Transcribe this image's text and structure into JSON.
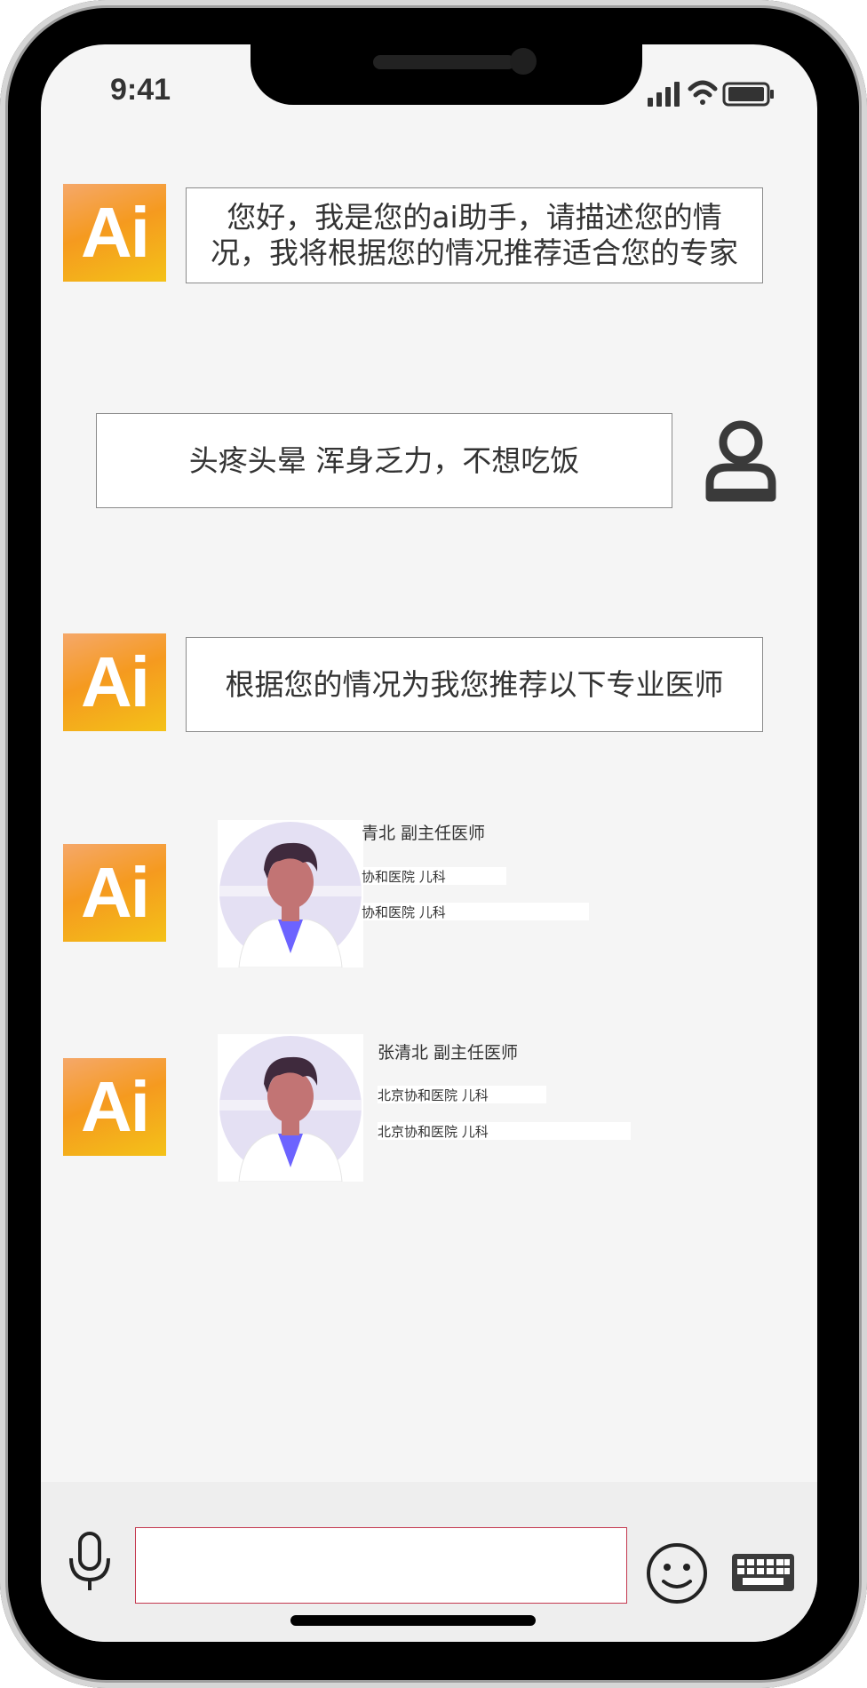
{
  "status_bar": {
    "time": "9:41"
  },
  "chat": {
    "avatar_text": "Ai",
    "messages": [
      {
        "from": "ai",
        "line1": "您好，我是您的ai助手，请描述您的情",
        "line2": "况，我将根据您的情况推荐适合您的专家"
      },
      {
        "from": "user",
        "text": "头疼头晕  浑身乏力，不想吃饭"
      },
      {
        "from": "ai",
        "text": "根据您的情况为我您推荐以下专业医师"
      }
    ],
    "doctors": [
      {
        "name_title": "青北    副主任医师",
        "hospital_dept_1": "协和医院        儿科",
        "hospital_dept_2": "协和医院        儿科"
      },
      {
        "name_title": "张清北    副主任医师",
        "hospital_dept_1": "北京协和医院        儿科",
        "hospital_dept_2": "北京协和医院        儿科"
      }
    ]
  },
  "input_bar": {
    "placeholder": ""
  },
  "icons": [
    "user-icon",
    "microphone-icon",
    "emoji-icon",
    "keyboard-icon",
    "signal-icon",
    "wifi-icon",
    "battery-icon"
  ],
  "colors": {
    "ai_gradient_start": "#f5a86a",
    "ai_gradient_end": "#f4c218",
    "input_border": "#c4384f"
  }
}
